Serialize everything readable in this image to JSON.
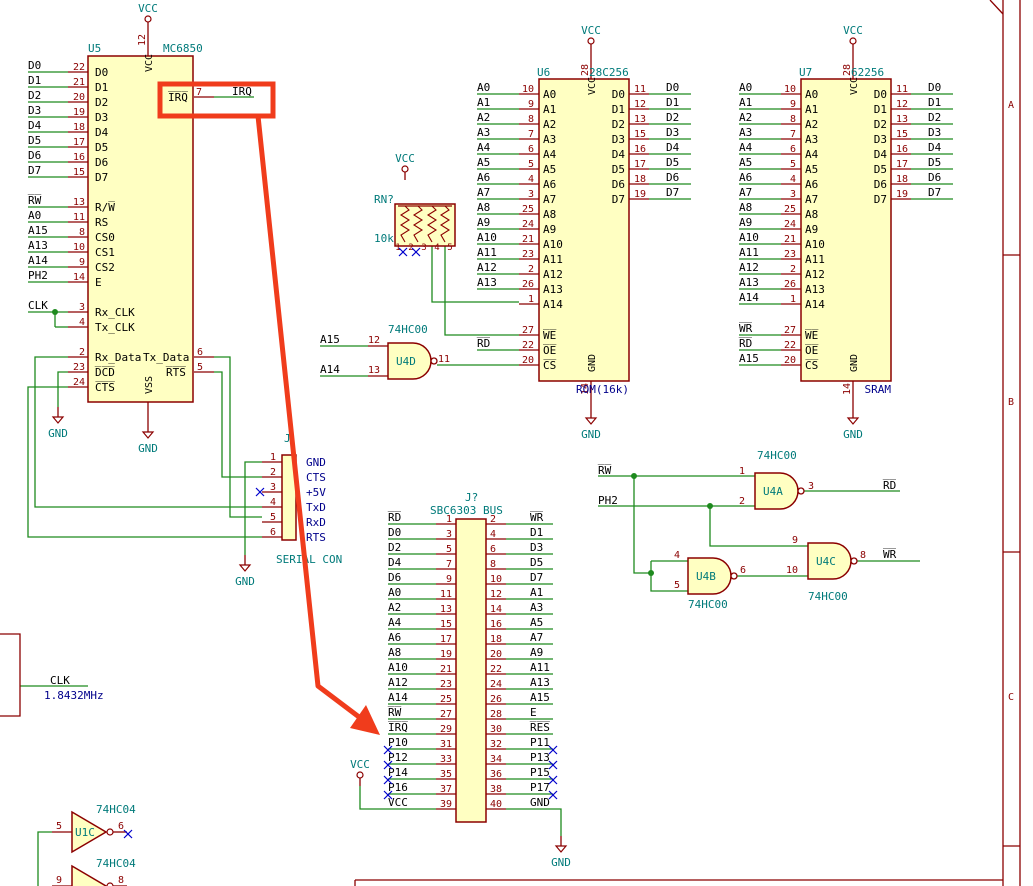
{
  "colors": {
    "wire": "#1e8a1e",
    "body_fill": "#ffffc2",
    "body_stroke": "#8b0000",
    "pin_stroke": "#8b0000",
    "ref_text": "#007a7a",
    "pin_text": "#8b0000",
    "net_text": "#000000",
    "blue_text": "#00008b",
    "highlight": "#f03c1c",
    "noconnect": "#0000cc"
  },
  "power": {
    "vcc": "VCC",
    "gnd": "GND"
  },
  "sheet_zones": [
    "A",
    "B",
    "C"
  ],
  "u5": {
    "ref": "U5",
    "value": "MC6850",
    "vcc_pin": "12",
    "vss_label": "VSS",
    "vss_pin": "VCC",
    "left_pins": [
      {
        "net": "D0",
        "num": "22",
        "name": "D0"
      },
      {
        "net": "D1",
        "num": "21",
        "name": "D1"
      },
      {
        "net": "D2",
        "num": "20",
        "name": "D2"
      },
      {
        "net": "D3",
        "num": "19",
        "name": "D3"
      },
      {
        "net": "D4",
        "num": "18",
        "name": "D4"
      },
      {
        "net": "D5",
        "num": "17",
        "name": "D5"
      },
      {
        "net": "D6",
        "num": "16",
        "name": "D6"
      },
      {
        "net": "D7",
        "num": "15",
        "name": "D7"
      },
      {
        "net": "R̅W̅",
        "num": "13",
        "name": "R/W̅"
      },
      {
        "net": "A0",
        "num": "11",
        "name": "RS"
      },
      {
        "net": "A15",
        "num": "8",
        "name": "CS0"
      },
      {
        "net": "A13",
        "num": "10",
        "name": "CS1"
      },
      {
        "net": "A14",
        "num": "9",
        "name": "CS2"
      },
      {
        "net": "PH2",
        "num": "14",
        "name": "E"
      },
      {
        "net": "CLK",
        "num": "3",
        "name": "Rx_CLK"
      },
      {
        "net": "",
        "num": "4",
        "name": "Tx_CLK"
      },
      {
        "net": "",
        "num": "2",
        "name": "Rx_Data"
      },
      {
        "net": "",
        "num": "23",
        "name": "D̅C̅D̅"
      },
      {
        "net": "",
        "num": "24",
        "name": "C̅T̅S̅"
      }
    ],
    "irq_name": "I̅R̅Q̅",
    "irq_num": "7",
    "irq_net": "I̅R̅Q̅",
    "tx_name": "Tx_Data",
    "tx_num": "6",
    "rts_name": "R̅T̅S̅",
    "rts_num": "5"
  },
  "u6": {
    "ref": "U6",
    "value": "28C256",
    "caption": "ROM(16k)",
    "vcc_pin": "28",
    "gnd_pin": "14",
    "gnd_name": "GND",
    "vcc_name": "VCC",
    "addr_pins": [
      {
        "net": "A0",
        "num": "10"
      },
      {
        "net": "A1",
        "num": "9"
      },
      {
        "net": "A2",
        "num": "8"
      },
      {
        "net": "A3",
        "num": "7"
      },
      {
        "net": "A4",
        "num": "6"
      },
      {
        "net": "A5",
        "num": "5"
      },
      {
        "net": "A6",
        "num": "4"
      },
      {
        "net": "A7",
        "num": "3"
      },
      {
        "net": "A8",
        "num": "25"
      },
      {
        "net": "A9",
        "num": "24"
      },
      {
        "net": "A10",
        "num": "21"
      },
      {
        "net": "A11",
        "num": "23"
      },
      {
        "net": "A12",
        "num": "2"
      },
      {
        "net": "A13",
        "num": "26"
      },
      {
        "net": "",
        "num": "1"
      }
    ],
    "data_pins": [
      {
        "net": "D0",
        "num": "11"
      },
      {
        "net": "D1",
        "num": "12"
      },
      {
        "net": "D2",
        "num": "13"
      },
      {
        "net": "D3",
        "num": "15"
      },
      {
        "net": "D4",
        "num": "16"
      },
      {
        "net": "D5",
        "num": "17"
      },
      {
        "net": "D6",
        "num": "18"
      },
      {
        "net": "D7",
        "num": "19"
      }
    ],
    "ctrl_pins": [
      {
        "net": "",
        "num": "27",
        "name": "W̅E̅"
      },
      {
        "net": "R̅D̅",
        "num": "22",
        "name": "O̅E̅"
      },
      {
        "net": "",
        "num": "20",
        "name": "C̅S̅"
      }
    ]
  },
  "u7": {
    "ref": "U7",
    "value": "62256",
    "caption": "SRAM",
    "vcc_pin": "28",
    "gnd_pin": "14",
    "gnd_name": "GND",
    "vcc_name": "VCC",
    "addr_pins": [
      {
        "net": "A0",
        "num": "10"
      },
      {
        "net": "A1",
        "num": "9"
      },
      {
        "net": "A2",
        "num": "8"
      },
      {
        "net": "A3",
        "num": "7"
      },
      {
        "net": "A4",
        "num": "6"
      },
      {
        "net": "A5",
        "num": "5"
      },
      {
        "net": "A6",
        "num": "4"
      },
      {
        "net": "A7",
        "num": "3"
      },
      {
        "net": "A8",
        "num": "25"
      },
      {
        "net": "A9",
        "num": "24"
      },
      {
        "net": "A10",
        "num": "21"
      },
      {
        "net": "A11",
        "num": "23"
      },
      {
        "net": "A12",
        "num": "2"
      },
      {
        "net": "A13",
        "num": "26"
      },
      {
        "net": "A14",
        "num": "1"
      }
    ],
    "data_pins": [
      {
        "net": "D0",
        "num": "11"
      },
      {
        "net": "D1",
        "num": "12"
      },
      {
        "net": "D2",
        "num": "13"
      },
      {
        "net": "D3",
        "num": "15"
      },
      {
        "net": "D4",
        "num": "16"
      },
      {
        "net": "D5",
        "num": "17"
      },
      {
        "net": "D6",
        "num": "18"
      },
      {
        "net": "D7",
        "num": "19"
      }
    ],
    "ctrl_pins": [
      {
        "net": "W̅R̅",
        "num": "27",
        "name": "W̅E̅"
      },
      {
        "net": "R̅D̅",
        "num": "22",
        "name": "O̅E̅"
      },
      {
        "net": "A15",
        "num": "20",
        "name": "C̅S̅"
      }
    ]
  },
  "rn": {
    "ref": "RN?",
    "value": "10k",
    "pins": [
      "1",
      "2",
      "3",
      "4",
      "5"
    ]
  },
  "u4d": {
    "ref": "U4D",
    "value": "74HC00",
    "in1_net": "A15",
    "in1_pin": "12",
    "in2_net": "A14",
    "in2_pin": "13",
    "out_pin": "11"
  },
  "u4a": {
    "ref": "U4A",
    "value": "74HC00",
    "in1_pin": "1",
    "in2_pin": "2",
    "out_pin": "3",
    "out_net": "R̅D̅"
  },
  "u4b": {
    "ref": "U4B",
    "value": "74HC00",
    "in1_pin": "4",
    "in2_pin": "5",
    "out_pin": "6"
  },
  "u4c": {
    "ref": "U4C",
    "value": "74HC00",
    "in1_pin": "9",
    "in2_pin": "10",
    "out_pin": "8",
    "out_net": "W̅R̅"
  },
  "u4_inputs": {
    "rw_net": "R̅W̅",
    "ph2_net": "PH2"
  },
  "serial_con": {
    "ref": "J",
    "value": "SERIAL CON",
    "pins": [
      {
        "num": "1",
        "label": "GND"
      },
      {
        "num": "2",
        "label": "CTS"
      },
      {
        "num": "3",
        "label": "+5V"
      },
      {
        "num": "4",
        "label": "TxD"
      },
      {
        "num": "5",
        "label": "RxD"
      },
      {
        "num": "6",
        "label": "RTS"
      }
    ]
  },
  "bus": {
    "ref": "J?",
    "value": "SBC6303 BUS",
    "rows": [
      {
        "l": "R̅D̅",
        "ln": "1",
        "rn": "2",
        "r": "W̅R̅"
      },
      {
        "l": "D0",
        "ln": "3",
        "rn": "4",
        "r": "D1"
      },
      {
        "l": "D2",
        "ln": "5",
        "rn": "6",
        "r": "D3"
      },
      {
        "l": "D4",
        "ln": "7",
        "rn": "8",
        "r": "D5"
      },
      {
        "l": "D6",
        "ln": "9",
        "rn": "10",
        "r": "D7"
      },
      {
        "l": "A0",
        "ln": "11",
        "rn": "12",
        "r": "A1"
      },
      {
        "l": "A2",
        "ln": "13",
        "rn": "14",
        "r": "A3"
      },
      {
        "l": "A4",
        "ln": "15",
        "rn": "16",
        "r": "A5"
      },
      {
        "l": "A6",
        "ln": "17",
        "rn": "18",
        "r": "A7"
      },
      {
        "l": "A8",
        "ln": "19",
        "rn": "20",
        "r": "A9"
      },
      {
        "l": "A10",
        "ln": "21",
        "rn": "22",
        "r": "A11"
      },
      {
        "l": "A12",
        "ln": "23",
        "rn": "24",
        "r": "A13"
      },
      {
        "l": "A14",
        "ln": "25",
        "rn": "26",
        "r": "A15"
      },
      {
        "l": "R̅W̅",
        "ln": "27",
        "rn": "28",
        "r": "E"
      },
      {
        "l": "I̅R̅Q̅",
        "ln": "29",
        "rn": "30",
        "r": "R̅E̅S̅"
      },
      {
        "l": "P10",
        "ln": "31",
        "rn": "32",
        "r": "P11"
      },
      {
        "l": "P12",
        "ln": "33",
        "rn": "34",
        "r": "P13"
      },
      {
        "l": "P14",
        "ln": "35",
        "rn": "36",
        "r": "P15"
      },
      {
        "l": "P16",
        "ln": "37",
        "rn": "38",
        "r": "P17"
      },
      {
        "l": "VCC",
        "ln": "39",
        "rn": "40",
        "r": "GND"
      }
    ]
  },
  "clock": {
    "net": "CLK",
    "freq": "1.8432MHz"
  },
  "u1c": {
    "ref": "U1C",
    "value": "74HC04",
    "in_pin": "5",
    "out_pin": "6"
  },
  "u1d": {
    "value": "74HC04",
    "in_pin": "9",
    "out_pin": "8"
  }
}
